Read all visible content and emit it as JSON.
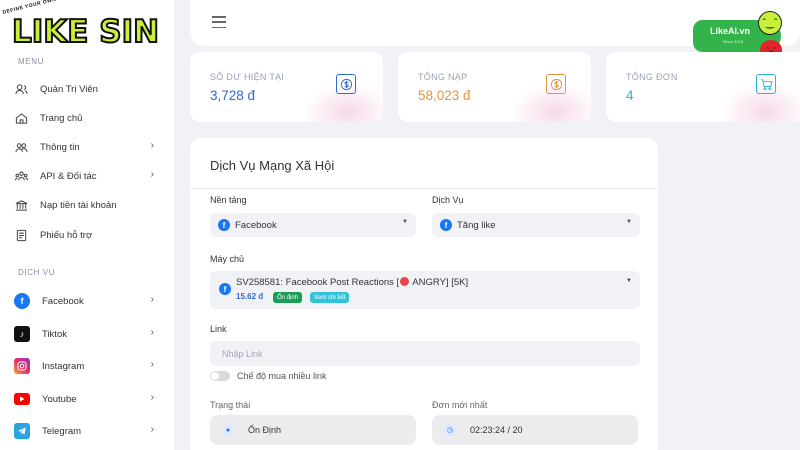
{
  "logo": {
    "text": "LIKE SIN",
    "tagline": "DEFINE YOUR OWN IDENTITY"
  },
  "sidebar": {
    "menu_label": "MENU",
    "menu": [
      {
        "label": "Quản Trị Viên",
        "icon": "admin-users-icon",
        "has_chevron": false
      },
      {
        "label": "Trang chủ",
        "icon": "home-icon",
        "has_chevron": false
      },
      {
        "label": "Thông tin",
        "icon": "info-users-icon",
        "has_chevron": true
      },
      {
        "label": "API & Đối tác",
        "icon": "partners-icon",
        "has_chevron": true
      },
      {
        "label": "Nạp tiền tài khoản",
        "icon": "bank-icon",
        "has_chevron": false
      },
      {
        "label": "Phiếu hỗ trợ",
        "icon": "ticket-icon",
        "has_chevron": false
      }
    ],
    "services_label": "DỊCH VỤ",
    "services": [
      {
        "label": "Facebook",
        "icon": "facebook-icon",
        "color": "#1877f2"
      },
      {
        "label": "Tiktok",
        "icon": "tiktok-icon",
        "color": "#111111"
      },
      {
        "label": "Instagram",
        "icon": "instagram-icon",
        "color": "#e1306c"
      },
      {
        "label": "Youtube",
        "icon": "youtube-icon",
        "color": "#ff0000"
      },
      {
        "label": "Telegram",
        "icon": "telegram-icon",
        "color": "#2aa3df"
      }
    ]
  },
  "header": {
    "brand_name": "LikeAI.vn",
    "brand_sub": "Since 2018"
  },
  "stats": [
    {
      "label": "SỐ DƯ HIỆN TẠI",
      "value": "3,728 đ",
      "color": "#2f6bd8",
      "icon": "dollar-icon"
    },
    {
      "label": "TỔNG NẠP",
      "value": "58,023 đ",
      "color": "#e3953b",
      "icon": "dollar-icon"
    },
    {
      "label": "TỔNG ĐƠN",
      "value": "4",
      "color": "#2bb5c7",
      "icon": "cart-icon"
    }
  ],
  "form": {
    "title": "Dịch Vụ Mạng Xã Hội",
    "platform_label": "Nền tảng",
    "platform_value": "Facebook",
    "service_label": "Dịch Vụ",
    "service_value": "Tăng like",
    "server_label": "Máy chủ",
    "server_name_prefix": "SV258581: Facebook Post Reactions [",
    "server_name_suffix": " ANGRY] [5K]",
    "server_price": "15.62 đ",
    "badge_stable": "Ổn định",
    "badge_stable_color": "#1a9e55",
    "badge_detail": "Xem chi tiết",
    "badge_detail_color": "#33c3d9",
    "link_label": "Link",
    "link_placeholder": "Nhập Link",
    "link_value": "",
    "multi_link_label": "Chế độ mua nhiều link",
    "multi_link_enabled": false,
    "status_label": "Trạng thái",
    "status_value": "Ổn Định",
    "latest_label": "Đơn mới nhất",
    "latest_value": "02:23:24 / 20"
  }
}
